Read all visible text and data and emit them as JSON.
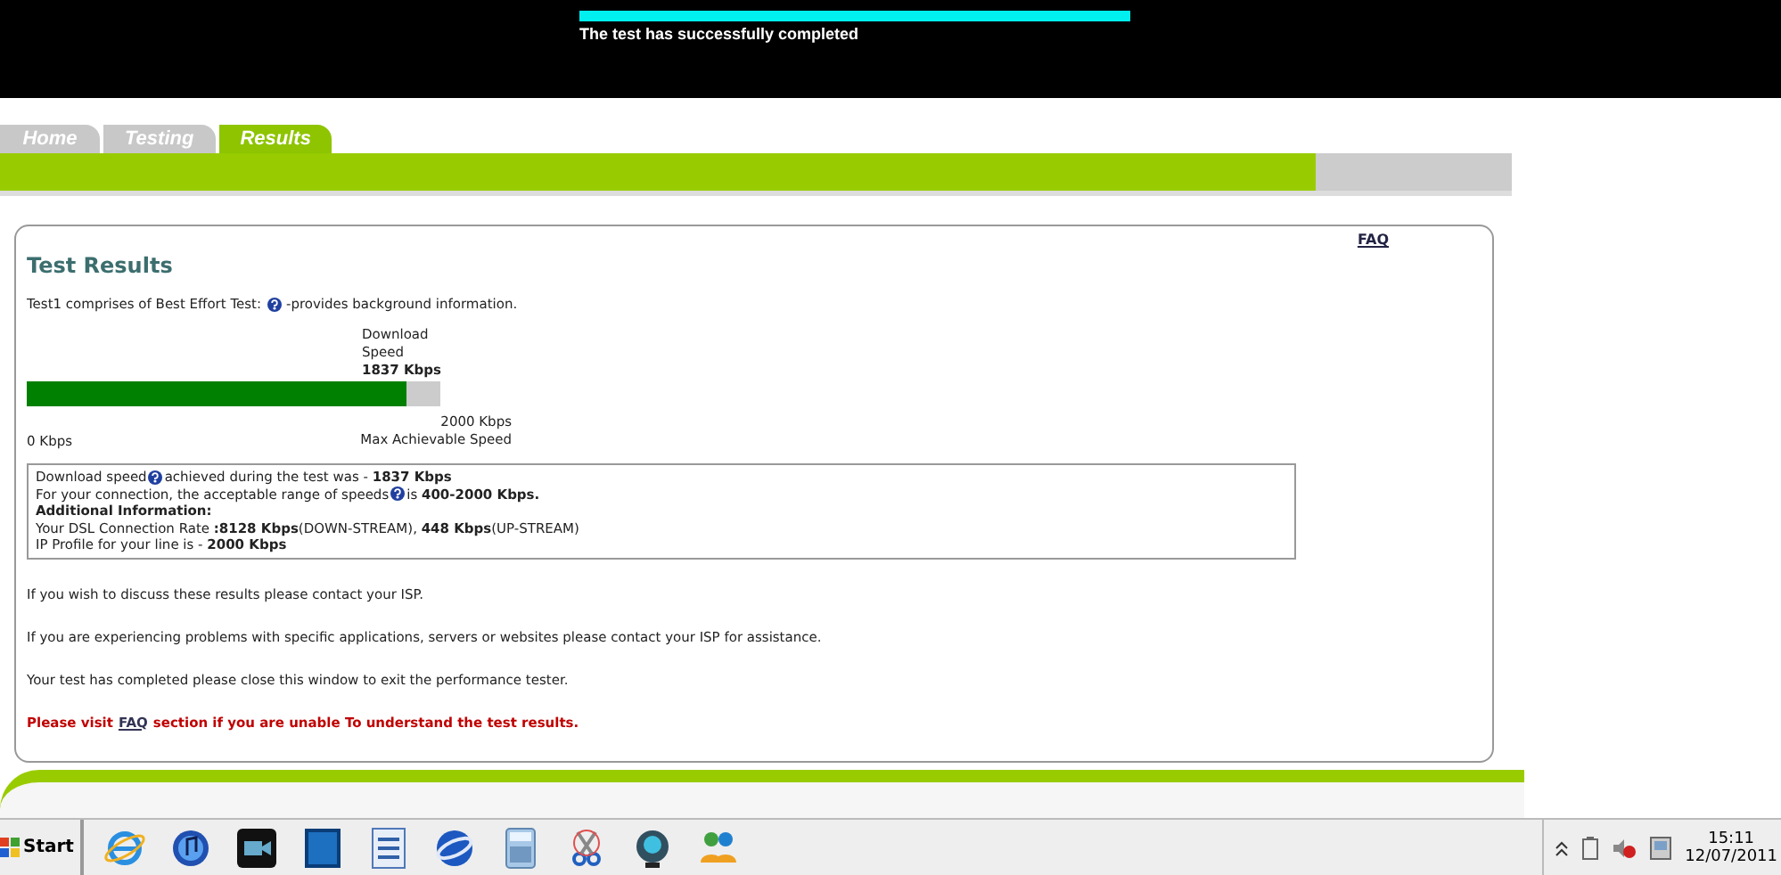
{
  "header": {
    "progress": {
      "level": 1
    },
    "message": "The test has successfully completed"
  },
  "tabs": [
    {
      "label": "Home",
      "selected": false
    },
    {
      "label": "Testing",
      "selected": false
    },
    {
      "label": "Results",
      "selected": true
    }
  ],
  "results": {
    "title": "Test Results",
    "faq_link": "FAQ",
    "intro": {
      "before": "Test1 comprises of Best Effort Test:",
      "after": "-provides background information."
    },
    "meter": {
      "caption": [
        "Download",
        "Speed"
      ],
      "value": "1837 Kbps",
      "level": 0.92,
      "min": "0 Kbps",
      "max": "2000 Kbps",
      "max_caption": "Max Achievable Speed"
    },
    "info_lines": [
      {
        "kind": "help",
        "before": "Download speed",
        "after": "achieved during the test was - **1837 Kbps**"
      },
      {
        "kind": "help",
        "before": "For your connection, the acceptable range of speeds",
        "after": "is **400-2000 Kbps.**"
      },
      {
        "kind": "heading",
        "text": "Additional Information:"
      },
      {
        "kind": "text",
        "text": "Your DSL Connection Rate **:8128 Kbps**(DOWN-STREAM), **448 Kbps**(UP-STREAM)"
      },
      {
        "kind": "text",
        "text": "IP Profile for your line is - **2000 Kbps**"
      }
    ],
    "paragraphs": [
      "If you wish to discuss these results please contact your ISP.",
      "If you are experiencing problems with specific applications, servers or websites please contact your ISP for assistance.",
      "Your test has completed please close this window to exit the performance tester."
    ],
    "notice": {
      "before": "Please visit",
      "link": "FAQ",
      "after": "section if you are unable To understand the test results."
    }
  },
  "taskbar": {
    "start": "Start",
    "time": "15:11",
    "date": "12/07/2011"
  }
}
